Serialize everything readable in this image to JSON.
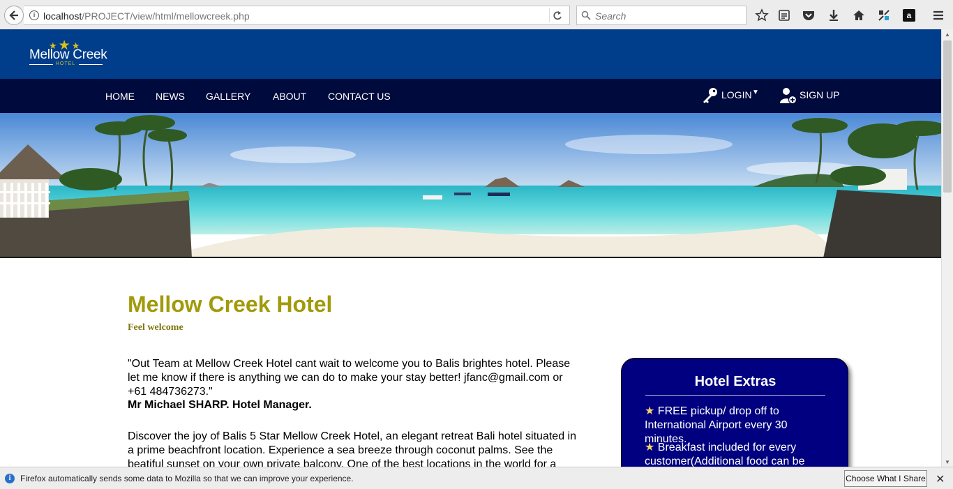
{
  "browser": {
    "url_host": "localhost",
    "url_path": "/PROJECT/view/html/mellowcreek.php",
    "search_placeholder": "Search"
  },
  "header": {
    "logo_name": "Mellow Creek",
    "logo_sub": "HOTEL"
  },
  "nav": {
    "items": [
      "HOME",
      "NEWS",
      "GALLERY",
      "ABOUT",
      "CONTACT US"
    ],
    "login": "LOGIN",
    "signup": "SIGN UP"
  },
  "main": {
    "title": "Mellow Creek Hotel",
    "subtitle": "Feel welcome",
    "quote": "\"Out Team at Mellow Creek Hotel cant wait to welcome you to Balis brightes hotel. Please let me know if there is anything we can do to make your stay better! jfanc@gmail.com or +61 484736273.\"",
    "manager": "Mr Michael SHARP. Hotel Manager.",
    "discover": "Discover the joy of Balis 5 Star Mellow Creek Hotel, an elegant retreat Bali hotel situated in a prime beachfront location. Experience a sea breeze through coconut palms. See the beatiful sunset on your own private balcony. One of the best locations in the world for a holiday, with lots"
  },
  "extras": {
    "title": "Hotel Extras",
    "items": [
      "FREE pickup/ drop off to International Airport every 30 minutes.",
      "Breakfast included for every customer(Additional food can be"
    ]
  },
  "notification": {
    "text": "Firefox automatically sends some data to Mozilla so that we can improve your experience.",
    "button": "Choose What I Share"
  },
  "colors": {
    "header_blue": "#003e8c",
    "nav_navy": "#000a3d",
    "title_olive": "#a19a0a",
    "extras_navy": "#000080"
  }
}
